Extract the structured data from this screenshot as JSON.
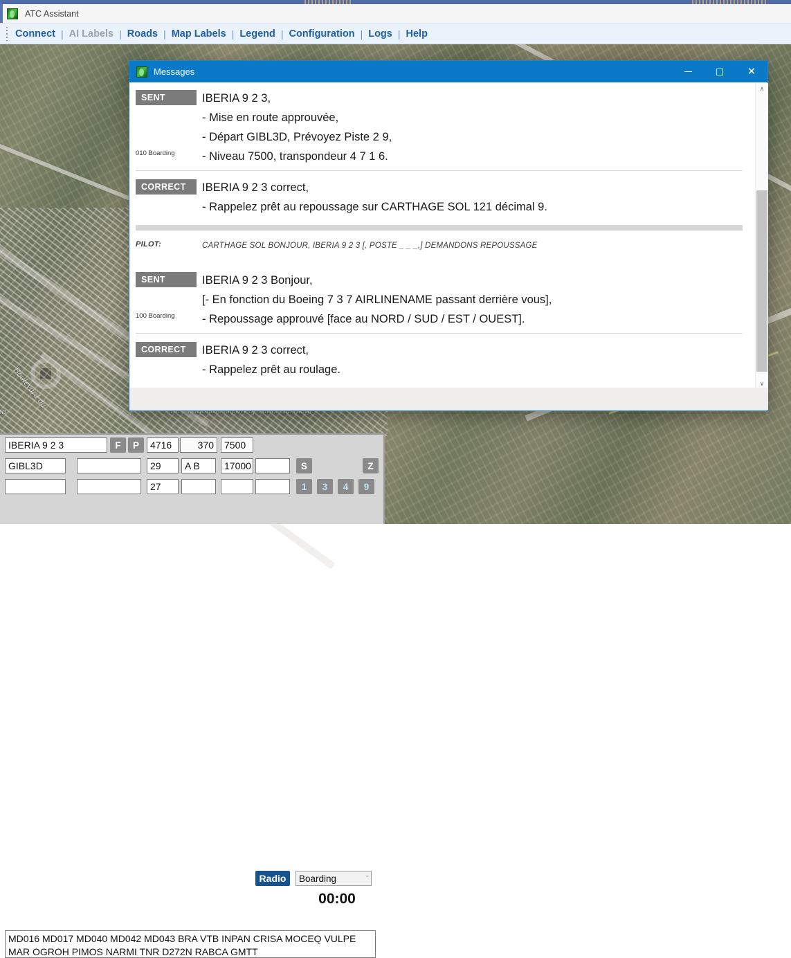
{
  "app": {
    "title": "ATC Assistant",
    "icon": "app-globe-icon"
  },
  "menu": {
    "items": [
      {
        "label": "Connect",
        "disabled": false
      },
      {
        "label": "AI Labels",
        "disabled": true
      },
      {
        "label": "Roads",
        "disabled": false
      },
      {
        "label": "Map Labels",
        "disabled": false
      },
      {
        "label": "Legend",
        "disabled": false
      },
      {
        "label": "Configuration",
        "disabled": false
      },
      {
        "label": "Logs",
        "disabled": false
      },
      {
        "label": "Help",
        "disabled": false
      }
    ],
    "separator": "|"
  },
  "map": {
    "airport_label": "International Airport of Tunis Carthage",
    "road_labels": [
      "Boulevard du",
      "on"
    ]
  },
  "dialog": {
    "title": "Messages",
    "icon": "app-globe-icon",
    "minimize_label": "–",
    "maximize_label": "☐",
    "close_label": "✕",
    "messages": [
      {
        "tag": "SENT",
        "sub_label": "010 Boarding",
        "lines": [
          "IBERIA 9 2 3,",
          "- Mise en route approuvée,",
          "- Départ GIBL3D, Prévoyez Piste 2 9,",
          "- Niveau 7500, transpondeur 4 7 1 6."
        ]
      },
      {
        "tag": "CORRECT",
        "sub_label": "",
        "lines": [
          "IBERIA 9 2 3 correct,",
          "- Rappelez prêt au repoussage sur CARTHAGE SOL 121 décimal 9."
        ]
      },
      {
        "tag": "PILOT:",
        "type": "pilot",
        "sub_label": "",
        "lines": [
          "CARTHAGE SOL BONJOUR, IBERIA 9 2 3 [, POSTE _ _ _,] DEMANDONS REPOUSSAGE"
        ]
      },
      {
        "tag": "SENT",
        "sub_label": "100 Boarding",
        "lines": [
          "IBERIA 9 2 3 Bonjour,",
          "[- En fonction du Boeing 7 3 7 AIRLINENAME passant derrière vous],",
          "- Repoussage approuvé [face au NORD / SUD / EST / OUEST]."
        ]
      },
      {
        "tag": "CORRECT",
        "sub_label": "",
        "lines": [
          "IBERIA 9 2 3 correct,",
          "- Rappelez prêt au roulage."
        ]
      }
    ],
    "scrollbar": {
      "up_arrow": "∧",
      "down_arrow": "∨"
    }
  },
  "panel": {
    "row1": {
      "callsign": "IBERIA 9 2 3",
      "f_button": "F",
      "p_button": "P",
      "squawk": "4716",
      "speed": "370",
      "altitude": "7500",
      "radio_button": "Radio",
      "status": "Boarding",
      "status_caret": "ˇ"
    },
    "row2": {
      "sid": "GIBL3D",
      "field2": "",
      "runway": "29",
      "stand": "A B",
      "level": "17000",
      "field6": "",
      "s_button": "S",
      "timer": "00:00",
      "z_button": "Z"
    },
    "row3": {
      "field1": "",
      "field2": "",
      "qnh": "27",
      "field4": "",
      "field5": "",
      "field6": "",
      "buttons": [
        "1",
        "3",
        "4",
        "9"
      ]
    },
    "route": "MD016 MD017 MD040 MD042 MD043 BRA VTB INPAN CRISA MOCEQ VULPE MAR OGROH PIMOS NARMI TNR D272N RABCA GMTT"
  },
  "colors": {
    "menu_text": "#1f5fa8",
    "dialog_titlebar": "#0a7ac8",
    "tag_bg": "#7b7b7b",
    "radio_bg": "#17548f",
    "button_bg": "#8a8a8a",
    "num_button_text": "#bfe4f7"
  }
}
